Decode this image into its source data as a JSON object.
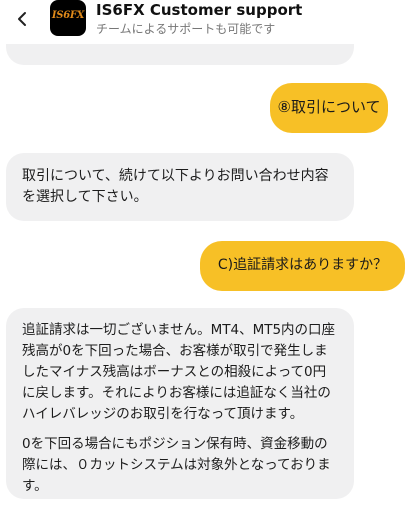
{
  "header": {
    "back_icon": "chevron-left-icon",
    "avatar_logo_text": "IS6FX",
    "title": "IS6FX Customer support",
    "subtitle": "チームによるサポートも可能です"
  },
  "colors": {
    "accent": "#f7c026",
    "incoming_bubble": "#f0f0f1",
    "logo_text": "#e08a1a"
  },
  "messages": [
    {
      "from": "user",
      "text": "⑧取引について"
    },
    {
      "from": "agent",
      "paragraphs": [
        "取引について、続けて以下よりお問い合わせ内容を選択して下さい。"
      ]
    },
    {
      "from": "user",
      "text": "C)追証請求はありますか？"
    },
    {
      "from": "agent",
      "paragraphs": [
        "追証請求は一切ございません。MT4、MT5内の口座残高が0を下回った場合、お客様が取引で発生しましたマイナス残高はボーナスとの相殺によって0円に戻します。それによりお客様には追証なく当社のハイレバレッジのお取引を行なって頂けます。",
        "0を下回る場合にもポジション保有時、資金移動の際には、０カットシステムは対象外となっております。"
      ]
    }
  ]
}
